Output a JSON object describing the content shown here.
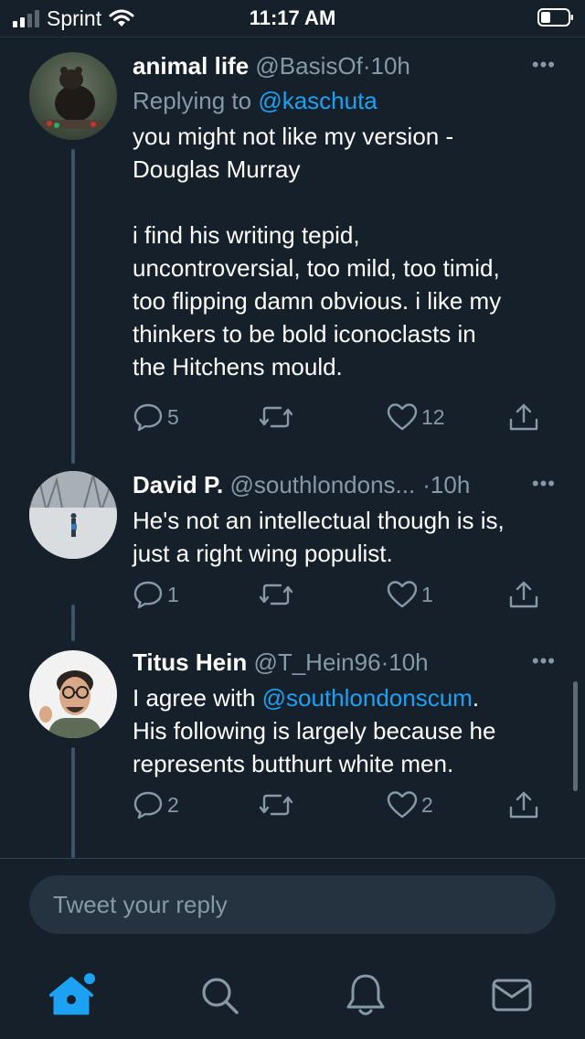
{
  "status_bar": {
    "carrier": "Sprint",
    "time": "11:17 AM",
    "signal_bars": 4,
    "signal_bars_filled": 2
  },
  "tweets": [
    {
      "name": "animal life",
      "handle": "@BasisOf",
      "separator": "·",
      "time": "10h",
      "replying_prefix": "Replying to",
      "replying_to": "@kaschuta",
      "text": "you might not like my version -\nDouglas Murray\n\ni find his writing tepid,\nuncontroversial, too mild, too timid,\ntoo flipping damn obvious. i like my\nthinkers to be bold iconoclasts in\nthe Hitchens mould.",
      "replies": "5",
      "retweets": "",
      "likes": "12",
      "more": "•••"
    },
    {
      "name": "David P.",
      "handle": "@southlondons...",
      "separator": "·",
      "time": "10h",
      "text": "He's not an intellectual though is is,\njust a right wing populist.",
      "replies": "1",
      "retweets": "",
      "likes": "1",
      "more": "•••"
    },
    {
      "name": "Titus Hein",
      "handle": "@T_Hein96",
      "separator": "·",
      "time": "10h",
      "text_prefix": "I agree with ",
      "text_mention": "@southlondonscum",
      "text_suffix": ".\nHis following is largely because he\nrepresents butthurt white men.",
      "replies": "2",
      "retweets": "",
      "likes": "2",
      "more": "•••"
    }
  ],
  "reply_box": {
    "placeholder": "Tweet your reply"
  },
  "tabbar": {
    "items": [
      "home-icon",
      "search-icon",
      "notifications-icon",
      "messages-icon"
    ],
    "active": "home-icon"
  },
  "colors": {
    "background": "#15202b",
    "accent": "#1da1f2",
    "secondary_text": "#8899a6",
    "thread_line": "#3d5466"
  }
}
